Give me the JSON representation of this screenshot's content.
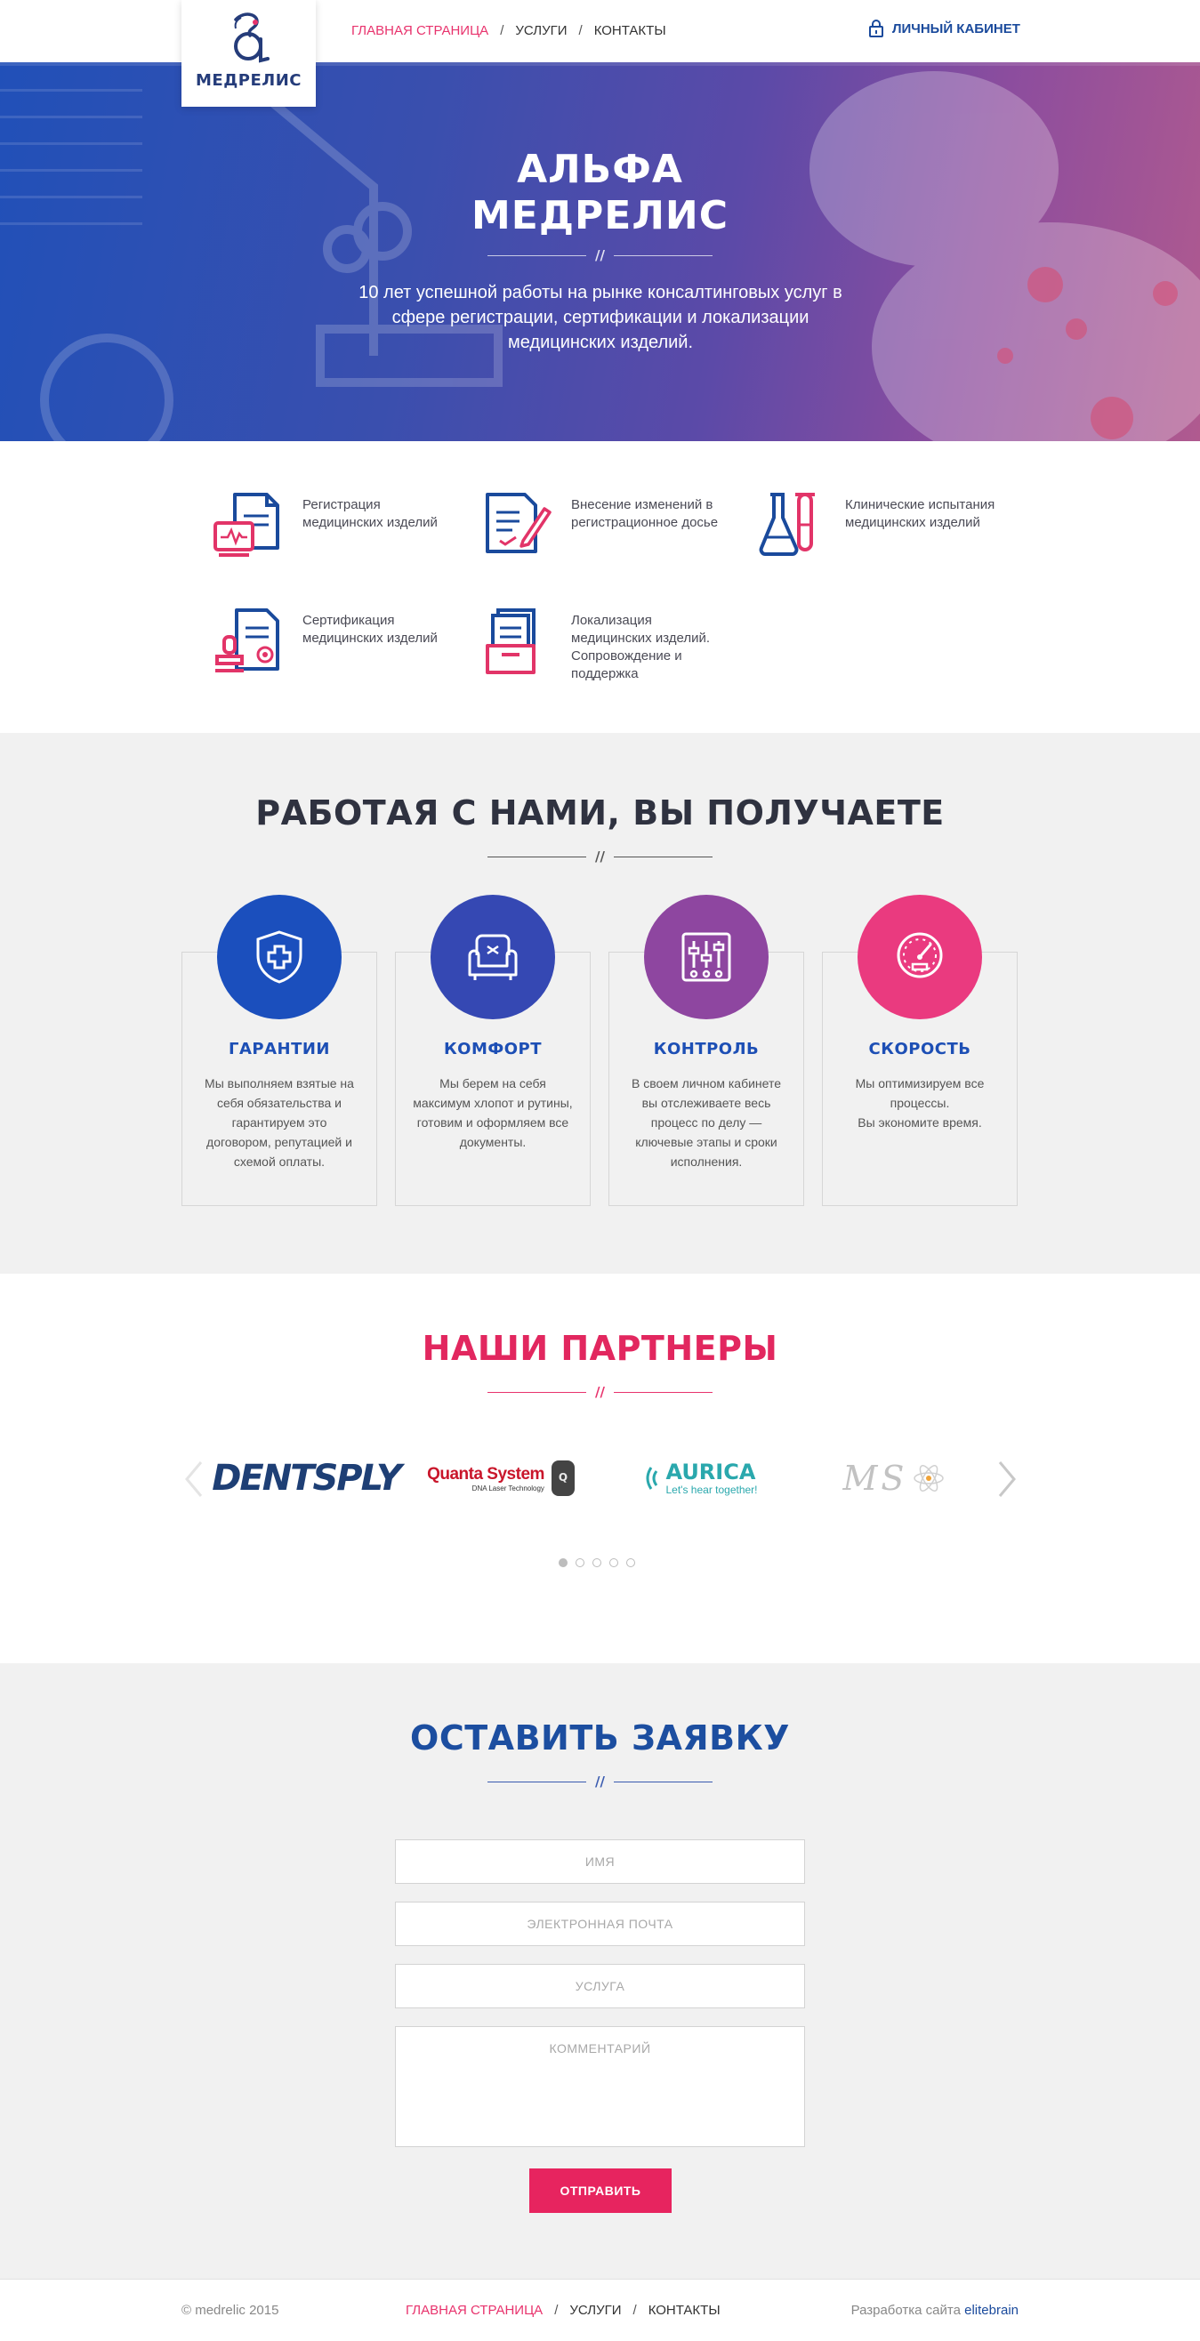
{
  "header": {
    "logo_text": "МЕДРЕЛИС",
    "nav": [
      {
        "label": "ГЛАВНАЯ СТРАНИЦА",
        "active": true
      },
      {
        "label": "УСЛУГИ",
        "active": false
      },
      {
        "label": "КОНТАКТЫ",
        "active": false
      }
    ],
    "nav_separator": "/",
    "cabinet_label": "ЛИЧНЫЙ КАБИНЕТ",
    "cabinet_icon": "lock-icon"
  },
  "hero": {
    "title_line1": "АЛЬФА",
    "title_line2": "МЕДРЕЛИС",
    "divider": "//",
    "subtitle": "10 лет успешной работы на рынке консалтинговых услуг в сфере регистрации, сертификации и локализации медицинских изделий."
  },
  "services": [
    {
      "label": "Регистрация медицинских изделий",
      "icon": "registration-document-icon"
    },
    {
      "label": "Внесение изменений в регистрационное досье",
      "icon": "edit-document-icon"
    },
    {
      "label": "Клинические испытания медицинских изделий",
      "icon": "flask-icon"
    },
    {
      "label": "Сертификация медицинских изделий",
      "icon": "stamp-certificate-icon"
    },
    {
      "label": "Локализация медицинских изделий. Сопровождение и поддержка",
      "icon": "archive-tray-icon"
    }
  ],
  "benefits": {
    "title": "РАБОТАЯ С НАМИ, ВЫ ПОЛУЧАЕТЕ",
    "divider": "//",
    "items": [
      {
        "title": "ГАРАНТИИ",
        "text": "Мы выполняем взятые на себя обязательства и гарантируем это договором, репутацией и схемой оплаты.",
        "icon": "shield-cross-icon",
        "color": "#1b4fbd"
      },
      {
        "title": "КОМФОРТ",
        "text": "Мы берем на себя максимум хлопот и рутины, готовим и оформляем все документы.",
        "icon": "armchair-icon",
        "color": "#3548b3"
      },
      {
        "title": "КОНТРОЛЬ",
        "text": "В своем личном кабинете вы отслеживаете весь процесс по делу — ключевые этапы и сроки исполнения.",
        "icon": "control-panel-icon",
        "color": "#8e46a0"
      },
      {
        "title": "СКОРОСТЬ",
        "text": "Мы оптимизируем все процессы.\nВы экономите время.",
        "icon": "speedometer-icon",
        "color": "#ea3a7f"
      }
    ]
  },
  "partners": {
    "title": "НАШИ ПАРТНЕРЫ",
    "divider": "//",
    "logos": [
      {
        "name": "DENTSPLY"
      },
      {
        "name": "Quanta System",
        "tagline": "DNA Laser Technology"
      },
      {
        "name": "AURICA",
        "tagline": "Let's hear together!"
      },
      {
        "name": "MS"
      }
    ],
    "dots_count": 5,
    "active_dot": 1
  },
  "form": {
    "title": "ОСТАВИТЬ ЗАЯВКУ",
    "divider": "//",
    "name_placeholder": "ИМЯ",
    "email_placeholder": "ЭЛЕКТРОННАЯ ПОЧТА",
    "service_placeholder": "УСЛУГА",
    "comment_placeholder": "КОММЕНТАРИЙ",
    "submit_label": "ОТПРАВИТЬ"
  },
  "footer": {
    "copyright": "© medrelic 2015",
    "nav": [
      {
        "label": "ГЛАВНАЯ СТРАНИЦА",
        "active": true
      },
      {
        "label": "УСЛУГИ",
        "active": false
      },
      {
        "label": "КОНТАКТЫ",
        "active": false
      }
    ],
    "dev_prefix": "Разработка сайта",
    "dev_link": "elitebrain"
  },
  "colors": {
    "accent_pink": "#e8336d",
    "brand_blue": "#1a4a9c",
    "form_title_blue": "#1c4ea0",
    "section_bg": "#f1f1f1"
  }
}
